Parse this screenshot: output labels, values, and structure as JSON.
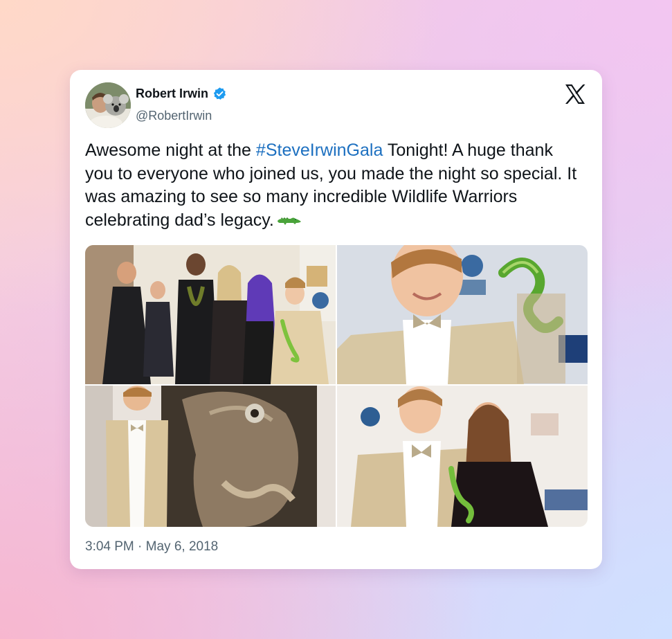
{
  "tweet": {
    "author": {
      "display_name": "Robert Irwin",
      "handle": "@RobertIrwin",
      "verified": true,
      "avatar_icon": "koala-photo"
    },
    "text_before": "Awesome night at the ",
    "hashtag": "#SteveIrwinGala",
    "text_after": " Tonight! A huge thank you to everyone who joined us, you made the night so special. It was amazing to see so many incredible Wildlife Warriors celebrating dad’s legacy.",
    "emoji": "crocodile",
    "timestamp": "3:04 PM · May 6, 2018",
    "platform_icon": "x-logo-icon"
  },
  "media": [
    {
      "id": "group-photo"
    },
    {
      "id": "snake-closeup-photo"
    },
    {
      "id": "iguana-photo"
    },
    {
      "id": "siblings-photo"
    }
  ],
  "colors": {
    "link": "#1d70c0",
    "verified": "#1d9bf0",
    "text": "#0f1419",
    "secondary": "#536471"
  }
}
